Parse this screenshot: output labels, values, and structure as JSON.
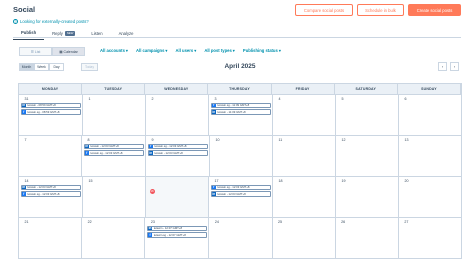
{
  "header": {
    "title": "Social",
    "looking_link": "Looking for externally-created posts?",
    "compare_btn": "Compare social posts",
    "schedule_btn": "Schedule in bulk",
    "create_btn": "Create social posts"
  },
  "tabs": [
    {
      "label": "Publish",
      "active": true
    },
    {
      "label": "Reply",
      "badge": "NEW"
    },
    {
      "label": "Listen"
    },
    {
      "label": "Analyze"
    }
  ],
  "view_toggle": {
    "list": "List",
    "calendar": "Calendar"
  },
  "filters": [
    "All accounts",
    "All campaigns",
    "All users",
    "All post types",
    "Publishing status"
  ],
  "range": {
    "month": "Month",
    "week": "Week",
    "day": "Day",
    "today": "Today"
  },
  "calendar": {
    "month_label": "April 2025",
    "weekdays": [
      "MONDAY",
      "TUESDAY",
      "WEDNESDAY",
      "THURSDAY",
      "FRIDAY",
      "SATURDAY",
      "SUNDAY"
    ],
    "weeks": [
      [
        {
          "day": "31",
          "posts": [
            {
              "net": "in",
              "text": "letswin - 08:59 GMT+8"
            },
            {
              "net": "f",
              "text": "letswin.sg - 08:59 GMT+8"
            }
          ]
        },
        {
          "day": "1",
          "posts": []
        },
        {
          "day": "2",
          "posts": []
        },
        {
          "day": "3",
          "posts": [
            {
              "net": "f",
              "text": "letswin.sg - 11:09 GMT+8"
            },
            {
              "net": "in",
              "text": "letswin - 11:09 GMT+8"
            }
          ]
        },
        {
          "day": "4",
          "posts": []
        },
        {
          "day": "5",
          "posts": []
        },
        {
          "day": "6",
          "posts": []
        }
      ],
      [
        {
          "day": "7",
          "posts": []
        },
        {
          "day": "8",
          "posts": [
            {
              "net": "in",
              "text": "letswin - 12:03 GMT+8"
            },
            {
              "net": "f",
              "text": "letswin.sg - 12:03 GMT+8"
            }
          ]
        },
        {
          "day": "9",
          "posts": [
            {
              "net": "f",
              "text": "letswin.sg - 12:03 GMT+8"
            },
            {
              "net": "in",
              "text": "letswin - 12:03 GMT+8"
            }
          ]
        },
        {
          "day": "10",
          "posts": []
        },
        {
          "day": "11",
          "posts": []
        },
        {
          "day": "12",
          "posts": []
        },
        {
          "day": "13",
          "posts": []
        }
      ],
      [
        {
          "day": "14",
          "posts": [
            {
              "net": "in",
              "text": "letswin - 12:03 GMT+8"
            },
            {
              "net": "f",
              "text": "letswin.sg - 12:03 GMT+8"
            }
          ]
        },
        {
          "day": "15",
          "posts": []
        },
        {
          "day": "16",
          "today": true,
          "posts": []
        },
        {
          "day": "17",
          "posts": [
            {
              "net": "f",
              "text": "letswin.sg - 12:03 GMT+8"
            },
            {
              "net": "in",
              "text": "letswin - 12:03 GMT+8"
            }
          ]
        },
        {
          "day": "18",
          "posts": []
        },
        {
          "day": "19",
          "posts": []
        },
        {
          "day": "20",
          "posts": []
        }
      ],
      [
        {
          "day": "21",
          "posts": []
        },
        {
          "day": "22",
          "posts": []
        },
        {
          "day": "23",
          "posts": [
            {
              "net": "in",
              "text": "letswin - 12:07 GMT+8"
            },
            {
              "net": "f",
              "text": "letswin.sg - 12:07 GMT+8"
            }
          ]
        },
        {
          "day": "24",
          "posts": []
        },
        {
          "day": "25",
          "posts": []
        },
        {
          "day": "26",
          "posts": []
        },
        {
          "day": "27",
          "posts": []
        }
      ]
    ]
  },
  "colors": {
    "accent": "#ff7a59",
    "link": "#0091ae",
    "text": "#33475b",
    "today": "#f2545b",
    "linkedin": "#0a66c2",
    "facebook": "#1877f2"
  }
}
